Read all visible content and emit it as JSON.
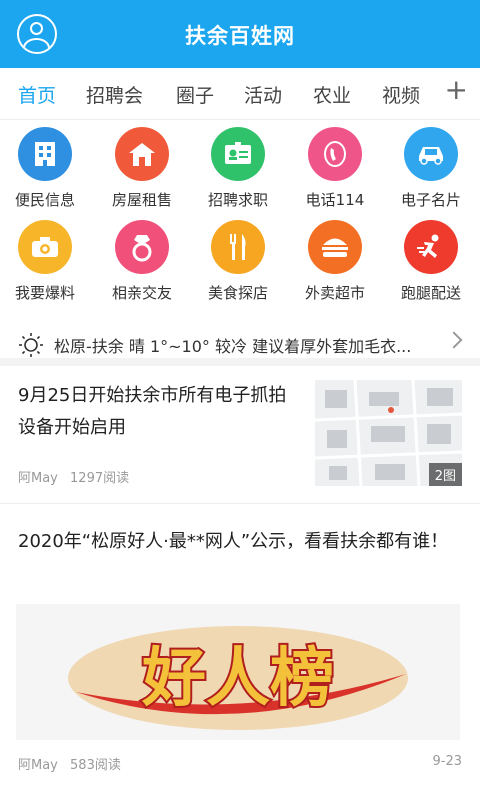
{
  "header": {
    "title": "扶余百姓网"
  },
  "tabs": [
    {
      "label": "首页",
      "active": true
    },
    {
      "label": "招聘会"
    },
    {
      "label": "圈子"
    },
    {
      "label": "活动"
    },
    {
      "label": "农业"
    },
    {
      "label": "视频"
    }
  ],
  "tab_more": "+",
  "shortcuts": [
    {
      "label": "便民信息",
      "icon": "building-icon",
      "color": "#2f8fe0"
    },
    {
      "label": "房屋租售",
      "icon": "house-icon",
      "color": "#f05a3a"
    },
    {
      "label": "招聘求职",
      "icon": "id-card-icon",
      "color": "#2fc26b"
    },
    {
      "label": "电话114",
      "icon": "phone-icon",
      "color": "#f0558a"
    },
    {
      "label": "电子名片",
      "icon": "car-icon",
      "color": "#2fa6ee"
    },
    {
      "label": "我要爆料",
      "icon": "camera-icon",
      "color": "#f7b52a"
    },
    {
      "label": "相亲交友",
      "icon": "ring-icon",
      "color": "#f0507a"
    },
    {
      "label": "美食探店",
      "icon": "cutlery-icon",
      "color": "#f7a621"
    },
    {
      "label": "外卖超市",
      "icon": "burger-icon",
      "color": "#f36f24"
    },
    {
      "label": "跑腿配送",
      "icon": "runner-icon",
      "color": "#ef3b2d"
    }
  ],
  "weather": {
    "text": "松原-扶余 晴 1°~10° 较冷 建议着厚外套加毛衣..."
  },
  "articles": [
    {
      "title": "9月25日开始扶余市所有电子抓拍设备开始启用",
      "author": "阿May",
      "reads": "1297阅读",
      "image_count": "2图"
    },
    {
      "title": "2020年“松原好人·最**网人”公示，看看扶余都有谁！",
      "author": "阿May",
      "reads": "583阅读",
      "date": "9-23",
      "banner_text": "好人榜"
    }
  ]
}
